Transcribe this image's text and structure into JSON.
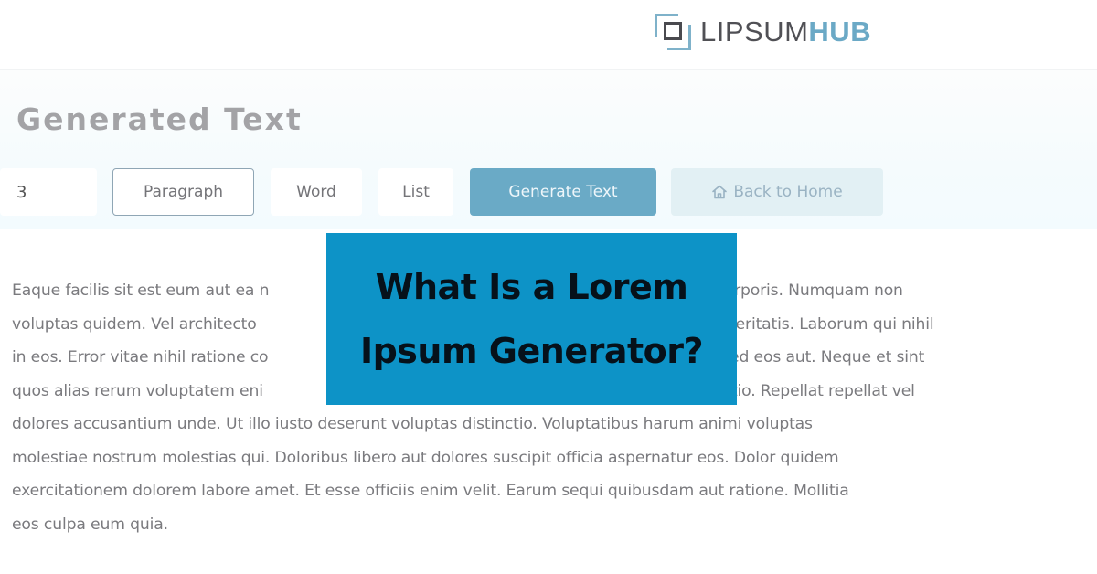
{
  "header": {
    "logo": {
      "icon": "stacked-squares-logo-icon",
      "text_primary": "LIPSUM",
      "text_accent": "HUB"
    }
  },
  "panel": {
    "title": "Generated Text",
    "quantity_value": "3",
    "options": [
      {
        "label": "Paragraph",
        "selected": true
      },
      {
        "label": "Word",
        "selected": false
      },
      {
        "label": "List",
        "selected": false
      }
    ],
    "generate_label": "Generate Text",
    "home_label": "Back to Home",
    "home_icon": "home-icon"
  },
  "generated_text": "Eaque facilis sit est eum aut ea n… sam corporis. Numquam non voluptas quidem. Vel architecto … porro veritatis. Laborum qui nihil in eos. Error vitae nihil ratione co… tque sed eos aut. Neque et sint quos alias rerum voluptatem eni… ur optio. Repellat repellat vel dolores accusantium unde. Ut illo iusto deserunt voluptas distinctio. Voluptatibus harum animi voluptas molestiae nostrum molestias qui. Doloribus libero aut dolores suscipit officia aspernatur eos. Dolor quidem exercitationem dolorem labore amet. Et esse officiis enim velit. Earum sequi quibusdam aut ratione. Mollitia eos culpa eum quia.",
  "generated_lines": [
    {
      "left": "Eaque facilis sit est eum aut ea n",
      "right": "sam corporis. Numquam non"
    },
    {
      "left": "voluptas quidem. Vel architecto",
      "right": "porro veritatis. Laborum qui nihil"
    },
    {
      "left": "in eos. Error vitae nihil ratione co",
      "right": "tque sed eos aut. Neque et sint"
    },
    {
      "left": "quos alias rerum voluptatem eni",
      "right": "ur optio. Repellat repellat vel"
    },
    {
      "full": "dolores accusantium unde. Ut illo iusto deserunt voluptas distinctio. Voluptatibus harum animi voluptas"
    },
    {
      "full": "molestiae nostrum molestias qui. Doloribus libero aut dolores suscipit officia aspernatur eos. Dolor quidem"
    },
    {
      "full": "exercitationem dolorem labore amet. Et esse officiis enim velit. Earum sequi quibusdam aut ratione. Mollitia"
    },
    {
      "full": "eos culpa eum quia."
    }
  ],
  "banner": {
    "line1": "What Is a Lorem",
    "line2": "Ipsum Generator?",
    "background": "#0d93c7",
    "text_color": "#06111a"
  },
  "colors": {
    "accent": "#6aaac6",
    "logo_dark": "#505055",
    "logo_accent": "#6ba9c6",
    "text_muted": "#7a7a7e"
  }
}
